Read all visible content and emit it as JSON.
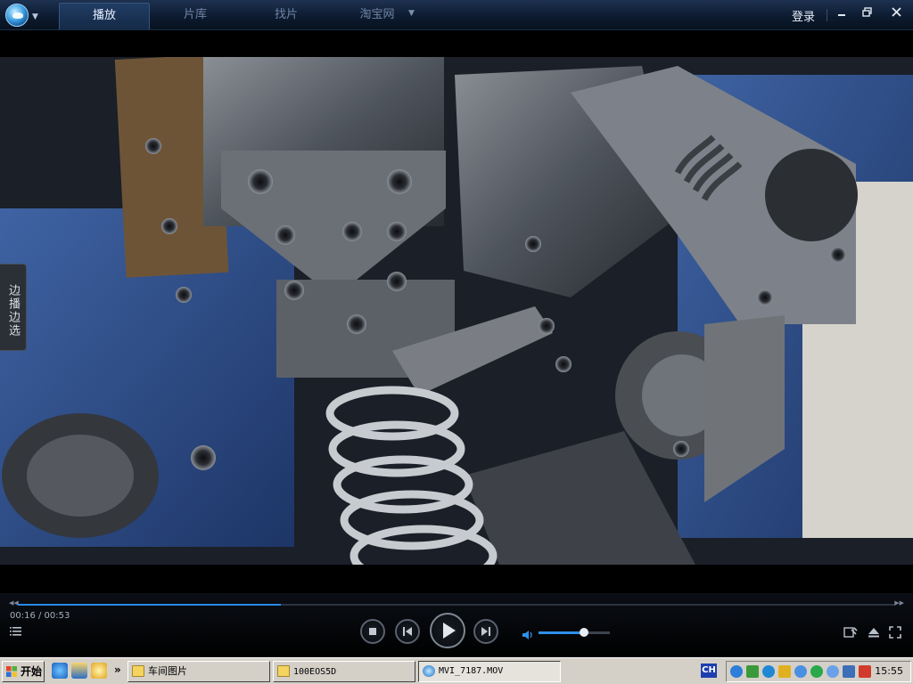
{
  "titlebar": {
    "tabs": [
      "播放",
      "片库",
      "找片",
      "淘宝网"
    ],
    "login": "登录",
    "window_buttons": [
      "minimize-icon",
      "restore-icon",
      "close-icon"
    ]
  },
  "video": {
    "side_tab": "边播边选",
    "content": "coil-spring-machine-closeup"
  },
  "controls": {
    "time": "00:16 / 00:53",
    "progress": 0.3,
    "volume": 0.64,
    "buttons": [
      "playlist-icon",
      "stop-icon",
      "previous-icon",
      "play-icon",
      "next-icon",
      "volume-icon",
      "settings-icon",
      "eject-icon",
      "fullscreen-icon"
    ]
  },
  "taskbar": {
    "start": "开始",
    "quick_launch": [
      "ie-icon",
      "outlook-icon",
      "messenger-icon"
    ],
    "overflow": "»",
    "tasks": [
      "车间图片",
      "100EOS5D",
      "MVI_7187.MOV"
    ],
    "ime": "CH",
    "clock": "15:55",
    "colors": {
      "accent": "#2a8ae6",
      "taskbar": "#d4d0c8"
    }
  }
}
